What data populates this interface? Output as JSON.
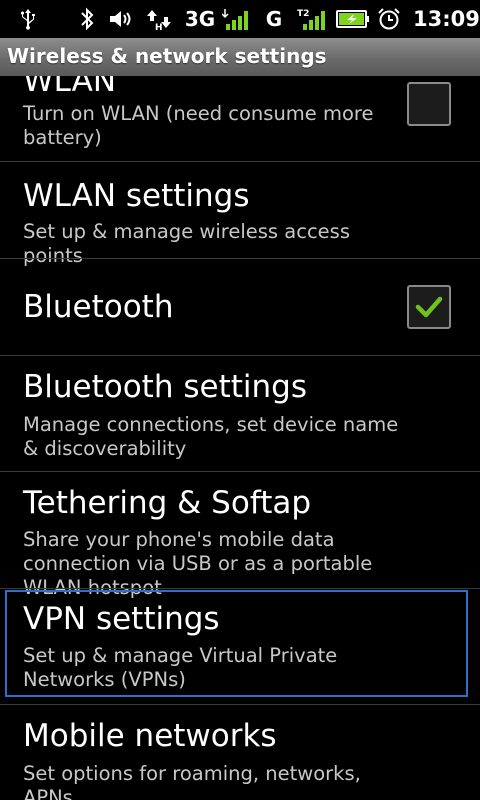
{
  "status_bar": {
    "network_3g": "3G",
    "network_g": "G",
    "time": "13:09",
    "icons": [
      "usb-icon",
      "bluetooth-icon",
      "volume-icon",
      "data-transfer-icon",
      "signal-icon",
      "signal-icon-2",
      "battery-charging-icon",
      "alarm-icon"
    ]
  },
  "title": "Wireless & network settings",
  "items": [
    {
      "title": "WLAN",
      "summary": "Turn on WLAN (need consume more battery)",
      "checkbox": false
    },
    {
      "title": "WLAN settings",
      "summary": "Set up & manage wireless access points"
    },
    {
      "title": "Bluetooth",
      "checkbox": true
    },
    {
      "title": "Bluetooth settings",
      "summary": "Manage connections, set device name & discoverability"
    },
    {
      "title": "Tethering & Softap",
      "summary": "Share your phone's mobile data connection via USB or as a portable WLAN hotspot"
    },
    {
      "title": "VPN settings",
      "summary": "Set up & manage Virtual Private Networks (VPNs)",
      "focused": true
    },
    {
      "title": "Mobile networks",
      "summary": "Set options for roaming, networks, APNs"
    }
  ],
  "colors": {
    "focus": "#2f6ec9",
    "check": "#6ec11e",
    "background": "#000000"
  }
}
